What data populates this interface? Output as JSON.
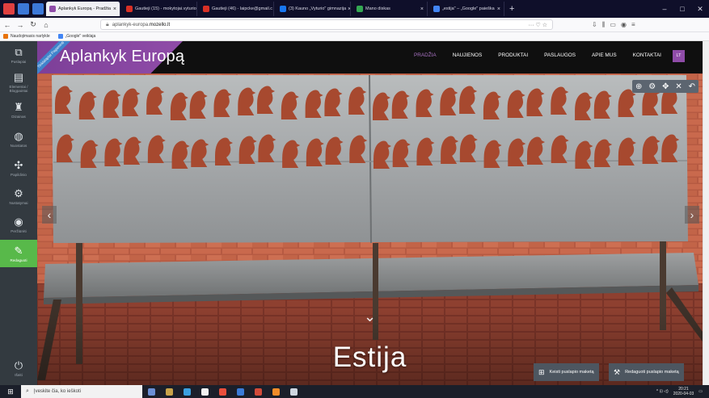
{
  "browser": {
    "tabs": [
      {
        "label": "Aplankyk Europą - Pradžia",
        "active": true,
        "color": "#8f4ca8"
      },
      {
        "label": "Gautieji (15) - mokytojai.vyturio",
        "active": false,
        "color": "#d93025"
      },
      {
        "label": "Gautieji (46) - laipcke@gmail.c",
        "active": false,
        "color": "#d93025"
      },
      {
        "label": "(3) Kauno „Vyturio\" gimnazija",
        "active": false,
        "color": "#1877f2"
      },
      {
        "label": "Mano diskas",
        "active": false,
        "color": "#34a853"
      },
      {
        "label": "„estija\" – „Google\" paieška",
        "active": false,
        "color": "#4285f4"
      }
    ],
    "new_tab_icon": "+",
    "window_controls": [
      "–",
      "□",
      "✕"
    ],
    "url_prefix": "aplankyk-europa.",
    "url_host": "mozello.lt",
    "url_actions": "··· ♡ ☆",
    "bookmarks": [
      "Naudojimasis narlykle",
      "„Google\" veiklaja"
    ]
  },
  "sidebar": {
    "items": [
      {
        "label": "Puslapiai",
        "icon": "pages-icon",
        "glyph": "⧉"
      },
      {
        "label": "Elementai / Blogpaintai",
        "icon": "layout-icon",
        "glyph": "▤"
      },
      {
        "label": "Dizainas",
        "icon": "brush-icon",
        "glyph": "♜"
      },
      {
        "label": "Nuostatos",
        "icon": "globe-icon",
        "glyph": "◍"
      },
      {
        "label": "Papildinio",
        "icon": "puzzle-icon",
        "glyph": "✣"
      },
      {
        "label": "Nustatymai",
        "icon": "gear-icon",
        "glyph": "⚙"
      },
      {
        "label": "Peržiūrėti",
        "icon": "eye-icon",
        "glyph": "◉"
      },
      {
        "label": "Redaguoti",
        "icon": "edit-icon",
        "glyph": "✎",
        "active": true
      },
      {
        "label": "Išeiti",
        "icon": "power-icon",
        "glyph": "⏻"
      }
    ]
  },
  "site": {
    "ribbon": "Tinklalapiai Pagaminti",
    "title": "Aplankyk Europą",
    "nav": [
      {
        "label": "PRADŽIA",
        "current": true
      },
      {
        "label": "NAUJIENOS",
        "current": false
      },
      {
        "label": "PRODUKTAI",
        "current": false
      },
      {
        "label": "PASLAUGOS",
        "current": false
      },
      {
        "label": "APIE MUS",
        "current": false
      },
      {
        "label": "KONTAKTAI",
        "current": false
      }
    ],
    "language": "LT",
    "block_tools": [
      "⊕",
      "⚙",
      "✥",
      "✕",
      "↶"
    ],
    "slider_prev": "‹",
    "slider_next": "›",
    "scroll_down": "⌄",
    "hero_title": "Estija",
    "buttons": [
      {
        "label": "Keisti puslapio maketą",
        "icon": "grid-icon",
        "glyph": "⊞"
      },
      {
        "label": "Redaguoti puslapio maketą",
        "icon": "wrench-icon",
        "glyph": "⚒"
      }
    ],
    "colors": {
      "accent": "#8f4ca8",
      "active_green": "#58b94a",
      "sidebar": "#333a40"
    }
  },
  "taskbar": {
    "start_icon": "⊞",
    "search_placeholder": "Įveskite čia, ko ieškoti",
    "apps": [
      "#6b8fd6",
      "#c8a34a",
      "#3aa0e0",
      "#f2f2f2",
      "#e94e3c",
      "#3b7bd8",
      "#d14b3a",
      "#f08c2a",
      "#cfd6e0"
    ],
    "tray": "^ ⊡ ◁)",
    "time": "20:21",
    "date": "2020-04-03"
  }
}
